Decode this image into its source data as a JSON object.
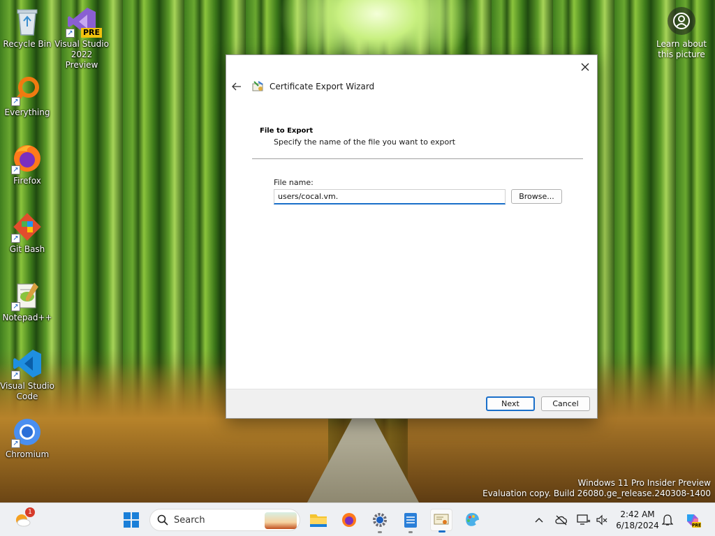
{
  "desktop": {
    "icons": [
      {
        "label": "Recycle Bin",
        "icon": "recycle-bin-icon"
      },
      {
        "label": "Visual Studio 2022 Preview",
        "icon": "visual-studio-preview-icon",
        "badge": "PRE"
      },
      {
        "label": "Everything",
        "icon": "everything-search-icon"
      },
      {
        "label": "Firefox",
        "icon": "firefox-icon"
      },
      {
        "label": "Git Bash",
        "icon": "git-bash-icon"
      },
      {
        "label": "Notepad++",
        "icon": "notepad-plus-plus-icon"
      },
      {
        "label": "Visual Studio Code",
        "icon": "vscode-icon"
      },
      {
        "label": "Chromium",
        "icon": "chromium-icon"
      }
    ],
    "learn_about": "Learn about this picture",
    "watermark": {
      "line1": "Windows 11 Pro Insider Preview",
      "line2": "Evaluation copy. Build 26080.ge_release.240308-1400"
    }
  },
  "dialog": {
    "title": "Certificate Export Wizard",
    "section_title": "File to Export",
    "section_subtitle": "Specify the name of the file you want to export",
    "file_label": "File name:",
    "file_value": "users/cocal.vm.",
    "browse_label": "Browse...",
    "next_label": "Next",
    "cancel_label": "Cancel"
  },
  "taskbar": {
    "search_label": "Search",
    "widgets_badge": "1",
    "clock_time": "2:42 AM",
    "clock_date": "6/18/2024",
    "accent": "#1a6fc9"
  }
}
